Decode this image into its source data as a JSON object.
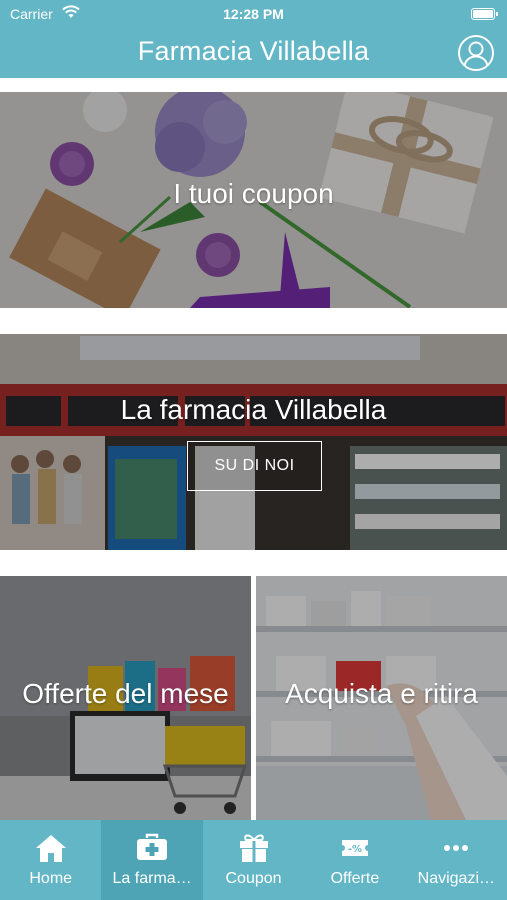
{
  "status_bar": {
    "carrier": "Carrier",
    "time": "12:28 PM"
  },
  "header": {
    "title": "Farmacia Villabella"
  },
  "tiles": {
    "coupon": {
      "label": "I tuoi coupon"
    },
    "farmacia": {
      "label": "La farmacia Villabella",
      "button": "SU DI NOI"
    },
    "offerte": {
      "label": "Offerte del mese"
    },
    "acquista": {
      "label": "Acquista e ritira"
    }
  },
  "tabbar": {
    "items": [
      {
        "label": "Home",
        "icon": "home-icon"
      },
      {
        "label": "La farma…",
        "icon": "medical-kit-icon"
      },
      {
        "label": "Coupon",
        "icon": "gift-icon"
      },
      {
        "label": "Offerte",
        "icon": "discount-tag-icon"
      },
      {
        "label": "Navigazi…",
        "icon": "more-dots-icon"
      }
    ]
  },
  "colors": {
    "accent": "#63b6c6",
    "tab_active": "#4ea4b5"
  }
}
